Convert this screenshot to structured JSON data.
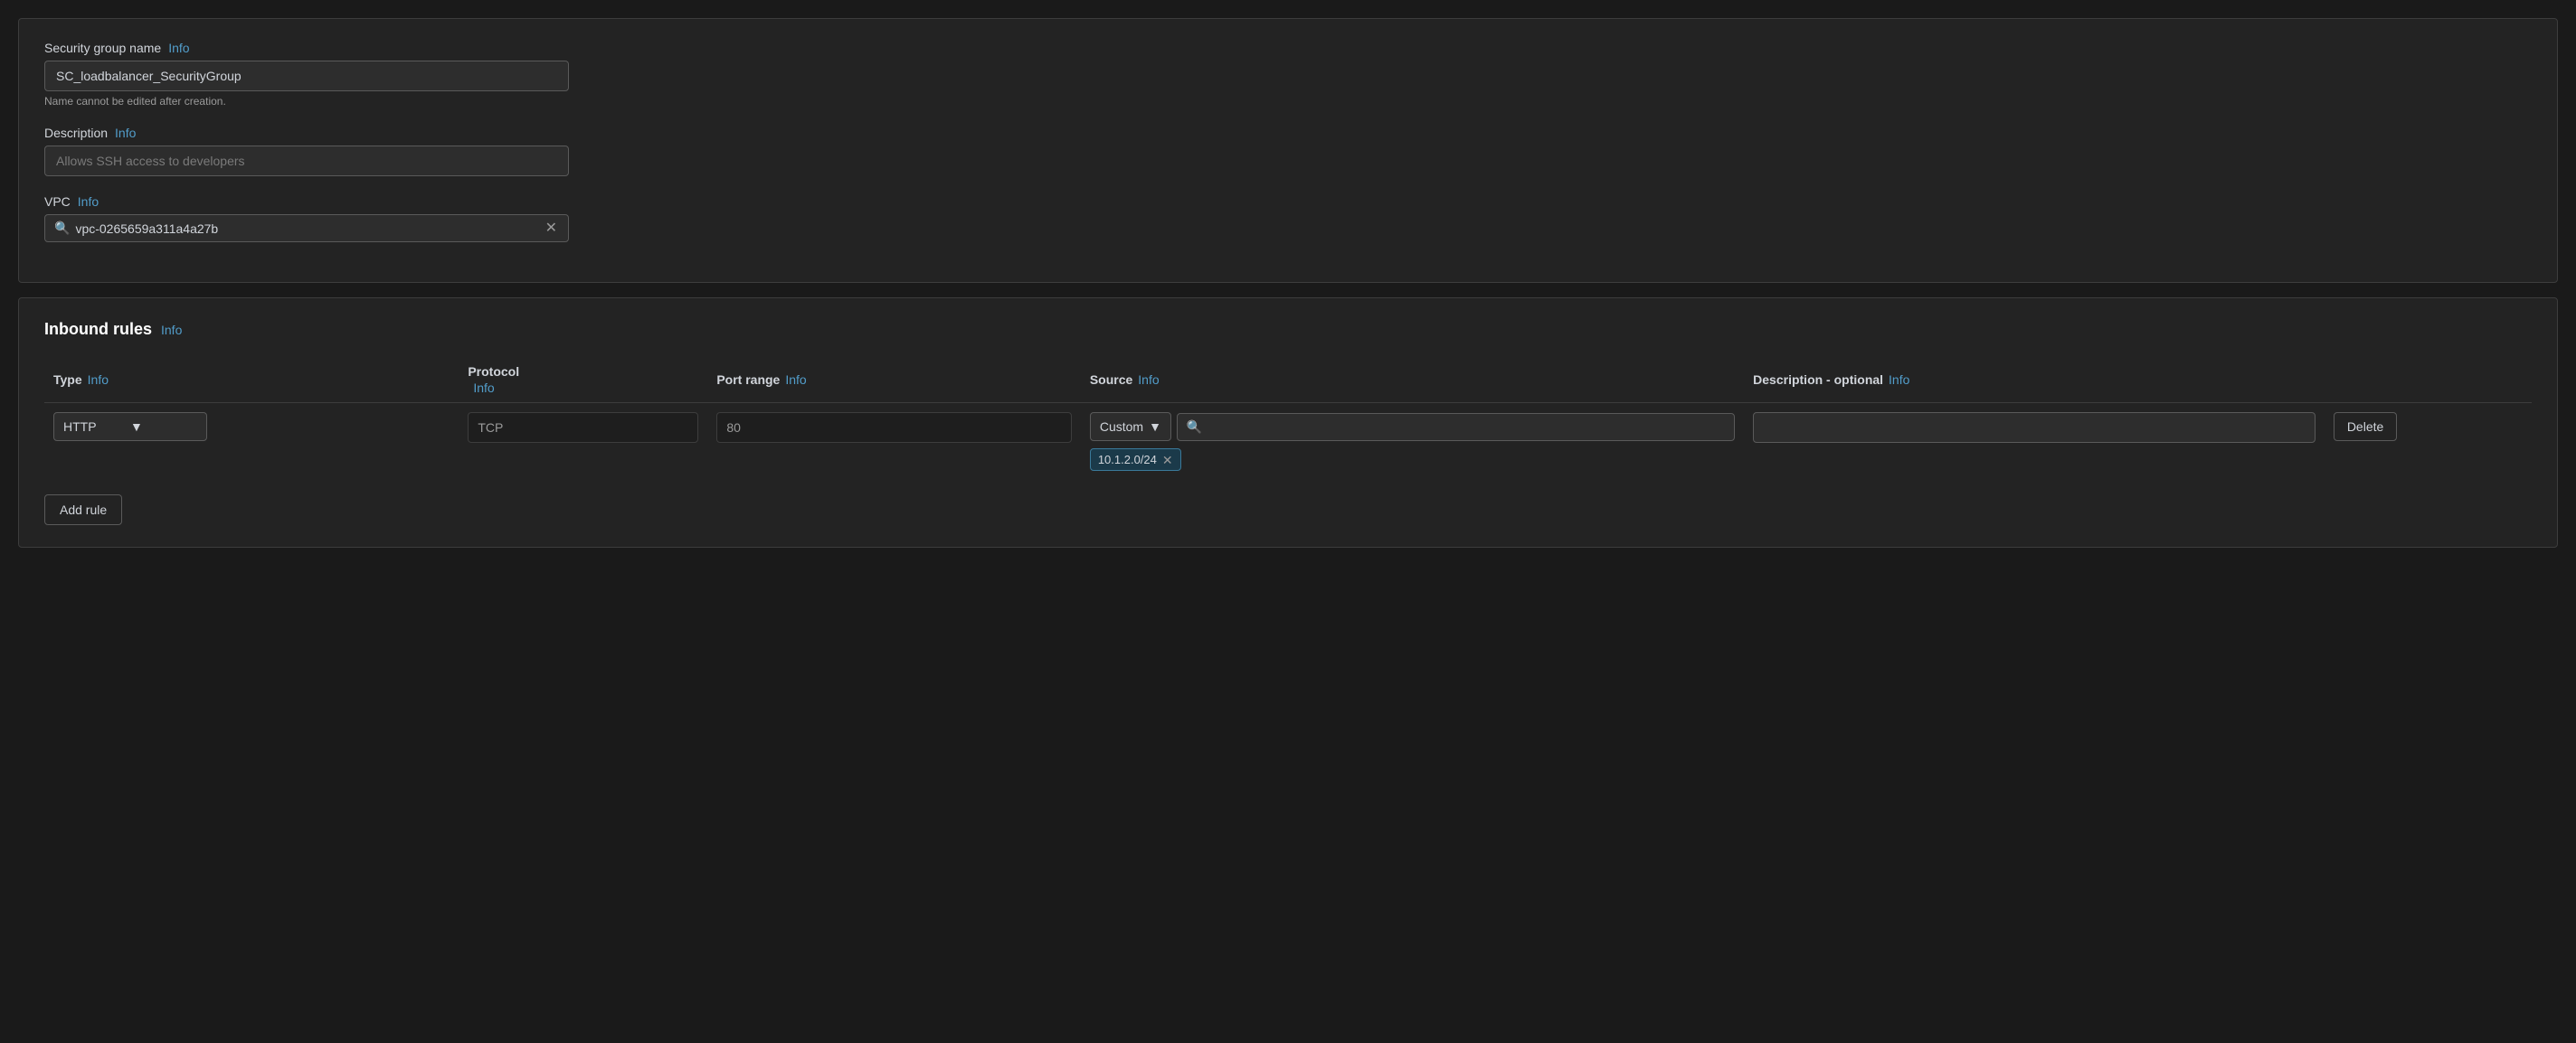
{
  "security_group_section": {
    "name_label": "Security group name",
    "name_info": "Info",
    "name_value": "SC_loadbalancer_SecurityGroup",
    "name_hint": "Name cannot be edited after creation.",
    "description_label": "Description",
    "description_info": "Info",
    "description_placeholder": "Allows SSH access to developers",
    "vpc_label": "VPC",
    "vpc_info": "Info",
    "vpc_value": "vpc-0265659a311a4a27b"
  },
  "inbound_rules_section": {
    "title": "Inbound rules",
    "title_info": "Info",
    "columns": {
      "type_label": "Type",
      "type_info": "Info",
      "protocol_label": "Protocol",
      "protocol_info": "Info",
      "port_range_label": "Port range",
      "port_range_info": "Info",
      "source_label": "Source",
      "source_info": "Info",
      "description_label": "Description - optional",
      "description_info": "Info"
    },
    "rules": [
      {
        "type": "HTTP",
        "protocol": "TCP",
        "port_range": "80",
        "source_type": "Custom",
        "source_search": "",
        "cidr_tag": "10.1.2.0/24",
        "description": ""
      }
    ],
    "delete_button_label": "Delete",
    "add_rule_label": "Add rule"
  }
}
